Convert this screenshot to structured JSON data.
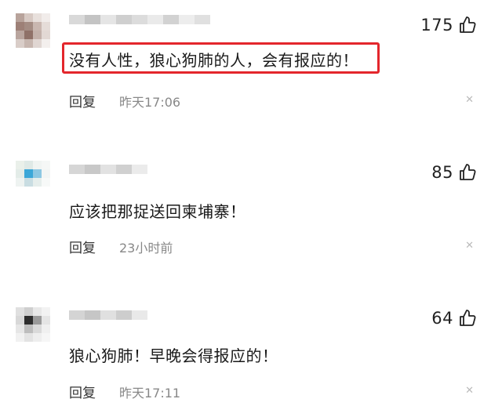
{
  "comments": [
    {
      "likes": "175",
      "text": "没有人性，狼心狗肺的人，会有报应的！",
      "reply_label": "回复",
      "time": "昨天17:06",
      "highlighted": true
    },
    {
      "likes": "85",
      "text": "应该把那捉送回柬埔寨！",
      "reply_label": "回复",
      "time": "23小时前",
      "highlighted": false
    },
    {
      "likes": "64",
      "text": "狼心狗肺！早晚会得报应的！",
      "reply_label": "回复",
      "time": "昨天17:11",
      "highlighted": false
    }
  ],
  "icons": {
    "like": "thumbs-up-icon",
    "close": "close-icon"
  },
  "colors": {
    "highlight_border": "#e3262c",
    "time_text": "#888888"
  }
}
